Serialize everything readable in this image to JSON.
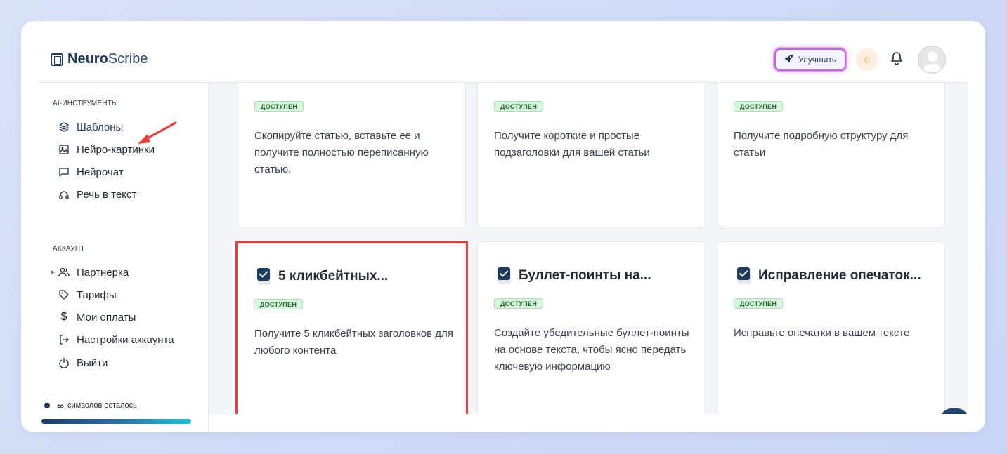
{
  "app": {
    "brand_bold": "Neuro",
    "brand_light": "Scribe"
  },
  "header": {
    "upgrade_label": "Улучшить"
  },
  "sidebar": {
    "section_tools": "AI-ИНСТРУМЕНТЫ",
    "tools": [
      {
        "label": "Шаблоны",
        "icon": "layers-icon"
      },
      {
        "label": "Нейро-картинки",
        "icon": "image-icon"
      },
      {
        "label": "Нейрочат",
        "icon": "chat-icon"
      },
      {
        "label": "Речь в текст",
        "icon": "headphones-icon"
      }
    ],
    "section_account": "АККАУНТ",
    "account": [
      {
        "label": "Партнерка",
        "icon": "users-icon"
      },
      {
        "label": "Тарифы",
        "icon": "tag-icon"
      },
      {
        "label": "Мои оплаты",
        "icon": "dollar-icon"
      },
      {
        "label": "Настройки аккаунта",
        "icon": "login-icon"
      },
      {
        "label": "Выйти",
        "icon": "power-icon"
      }
    ],
    "chars_infinity": "∞",
    "chars_label": "символов осталось",
    "chars_fill": 1.0
  },
  "cards": [
    {
      "badge": "ДОСТУПЕН",
      "desc": "Скопируйте статью, вставьте ее и получите полностью переписанную статью."
    },
    {
      "badge": "ДОСТУПЕН",
      "desc": "Получите короткие и простые подзаголовки для вашей статьи"
    },
    {
      "badge": "ДОСТУПЕН",
      "desc": "Получите подробную структуру для статьи"
    },
    {
      "title": "5 кликбейтных...",
      "badge": "ДОСТУПЕН",
      "desc": "Получите 5 кликбейтных заголовков для любого контента"
    },
    {
      "title": "Буллет-поинты на...",
      "badge": "ДОСТУПЕН",
      "desc": "Создайте убедительные буллет-поинты на основе текста, чтобы ясно передать ключевую информацию"
    },
    {
      "title": "Исправление опечаток...",
      "badge": "ДОСТУПЕН",
      "desc": "Исправьте опечатки в вашем тексте"
    }
  ],
  "colors": {
    "brand": "#1d3a5f",
    "highlight": "#ec3b3b",
    "badge_bg": "#d9f5dd"
  }
}
